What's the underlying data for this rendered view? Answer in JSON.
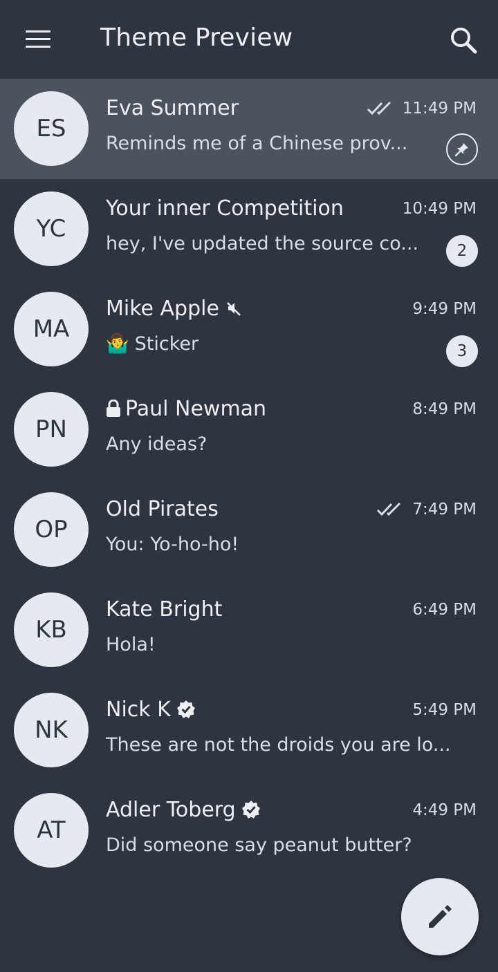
{
  "app": {
    "title": "Theme Preview"
  },
  "colors": {
    "background": "#2e3440",
    "selected_row": "#4c535f",
    "avatar_bg": "#e5e9f0",
    "text": "#eceff4"
  },
  "chats": [
    {
      "initials": "ES",
      "name": "Eva Summer",
      "time": "11:49 PM",
      "preview": "Reminds me of a Chinese prov...",
      "status_icon": "double-check-icon",
      "badge_icon": "pin-icon",
      "selected": true
    },
    {
      "initials": "YC",
      "name": "Your inner Competition",
      "time": "10:49 PM",
      "preview": "hey, I've updated the source co...",
      "badge": "2"
    },
    {
      "initials": "MA",
      "name": "Mike Apple",
      "name_icon": "muted-icon",
      "time": "9:49 PM",
      "preview_emoji": "🤷‍♂️",
      "preview": "Sticker",
      "badge": "3"
    },
    {
      "initials": "PN",
      "name": "Paul Newman",
      "name_prefix_icon": "lock-icon",
      "time": "8:49 PM",
      "preview": "Any ideas?"
    },
    {
      "initials": "OP",
      "name": "Old Pirates",
      "time": "7:49 PM",
      "preview": "You: Yo-ho-ho!",
      "status_icon": "double-check-icon"
    },
    {
      "initials": "KB",
      "name": "Kate Bright",
      "time": "6:49 PM",
      "preview": "Hola!"
    },
    {
      "initials": "NK",
      "name": "Nick K",
      "name_icon": "verified-icon",
      "time": "5:49 PM",
      "preview": "These are not the droids you are lo..."
    },
    {
      "initials": "AT",
      "name": "Adler Toberg",
      "name_icon": "verified-icon",
      "time": "4:49 PM",
      "preview": "Did someone say peanut butter?"
    }
  ],
  "fab": {
    "icon": "pencil-icon"
  }
}
